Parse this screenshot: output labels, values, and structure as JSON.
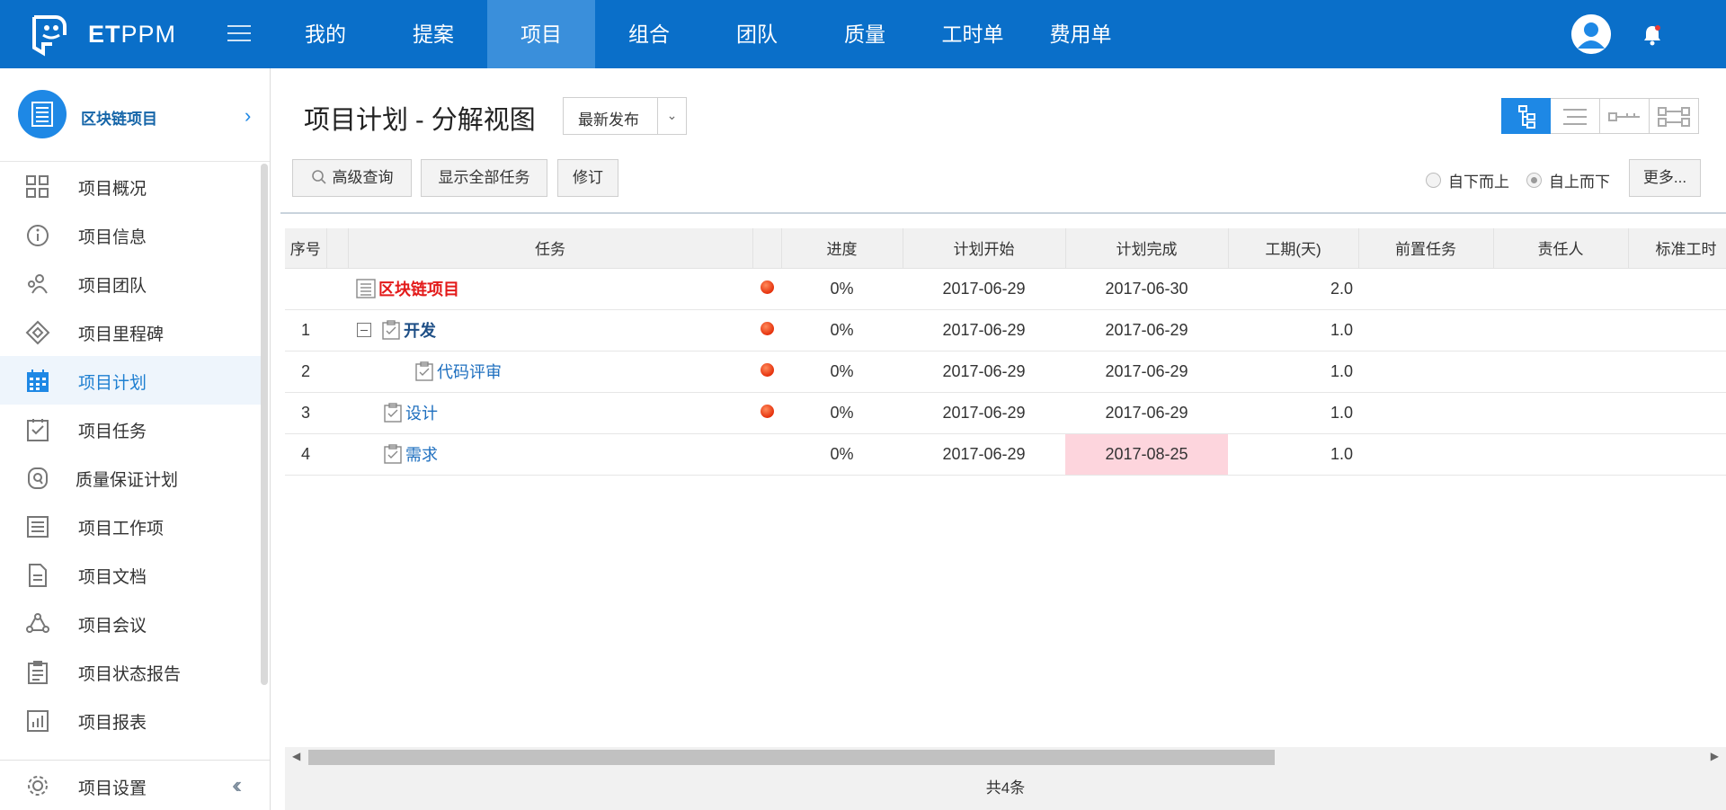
{
  "app": {
    "logo_text_bold": "ET",
    "logo_text": "PPM"
  },
  "nav": [
    "我的",
    "提案",
    "项目",
    "组合",
    "团队",
    "质量",
    "工时单",
    "费用单"
  ],
  "sidebar": {
    "project_name": "区块链项目",
    "items": [
      {
        "label": "项目概况",
        "icon": "grid-icon"
      },
      {
        "label": "项目信息",
        "icon": "info-icon"
      },
      {
        "label": "项目团队",
        "icon": "team-icon"
      },
      {
        "label": "项目里程碑",
        "icon": "milestone-icon"
      },
      {
        "label": "项目计划",
        "icon": "calendar-icon"
      },
      {
        "label": "项目任务",
        "icon": "checklist-icon"
      },
      {
        "label": "质量保证计划",
        "icon": "quality-icon"
      },
      {
        "label": "项目工作项",
        "icon": "list-icon"
      },
      {
        "label": "项目文档",
        "icon": "document-icon"
      },
      {
        "label": "项目会议",
        "icon": "meeting-icon"
      },
      {
        "label": "项目状态报告",
        "icon": "report-icon"
      },
      {
        "label": "项目报表",
        "icon": "chart-icon"
      }
    ],
    "settings_label": "项目设置"
  },
  "page": {
    "title": "项目计划 - 分解视图",
    "version": "最新发布",
    "buttons": {
      "search": "高级查询",
      "show_all": "显示全部任务",
      "revise": "修订",
      "more": "更多..."
    },
    "radios": {
      "bottom_up": "自下而上",
      "top_down": "自上而下"
    },
    "colors": {
      "accent": "#0a6fc9",
      "late": "#fdd5dd",
      "root_task": "#e31a1a"
    }
  },
  "grid": {
    "columns": [
      "序号",
      "任务",
      "进度",
      "计划开始",
      "计划完成",
      "工期(天)",
      "前置任务",
      "责任人",
      "标准工时"
    ],
    "rows": [
      {
        "seq": "",
        "task": "区块链项目",
        "progress": "0%",
        "start": "2017-06-29",
        "finish": "2017-06-30",
        "duration": "2.0"
      },
      {
        "seq": "1",
        "task": "开发",
        "progress": "0%",
        "start": "2017-06-29",
        "finish": "2017-06-29",
        "duration": "1.0"
      },
      {
        "seq": "2",
        "task": "代码评审",
        "progress": "0%",
        "start": "2017-06-29",
        "finish": "2017-06-29",
        "duration": "1.0"
      },
      {
        "seq": "3",
        "task": "设计",
        "progress": "0%",
        "start": "2017-06-29",
        "finish": "2017-06-29",
        "duration": "1.0"
      },
      {
        "seq": "4",
        "task": "需求",
        "progress": "0%",
        "start": "2017-06-29",
        "finish": "2017-08-25",
        "duration": "1.0"
      }
    ],
    "footer": "共4条"
  }
}
